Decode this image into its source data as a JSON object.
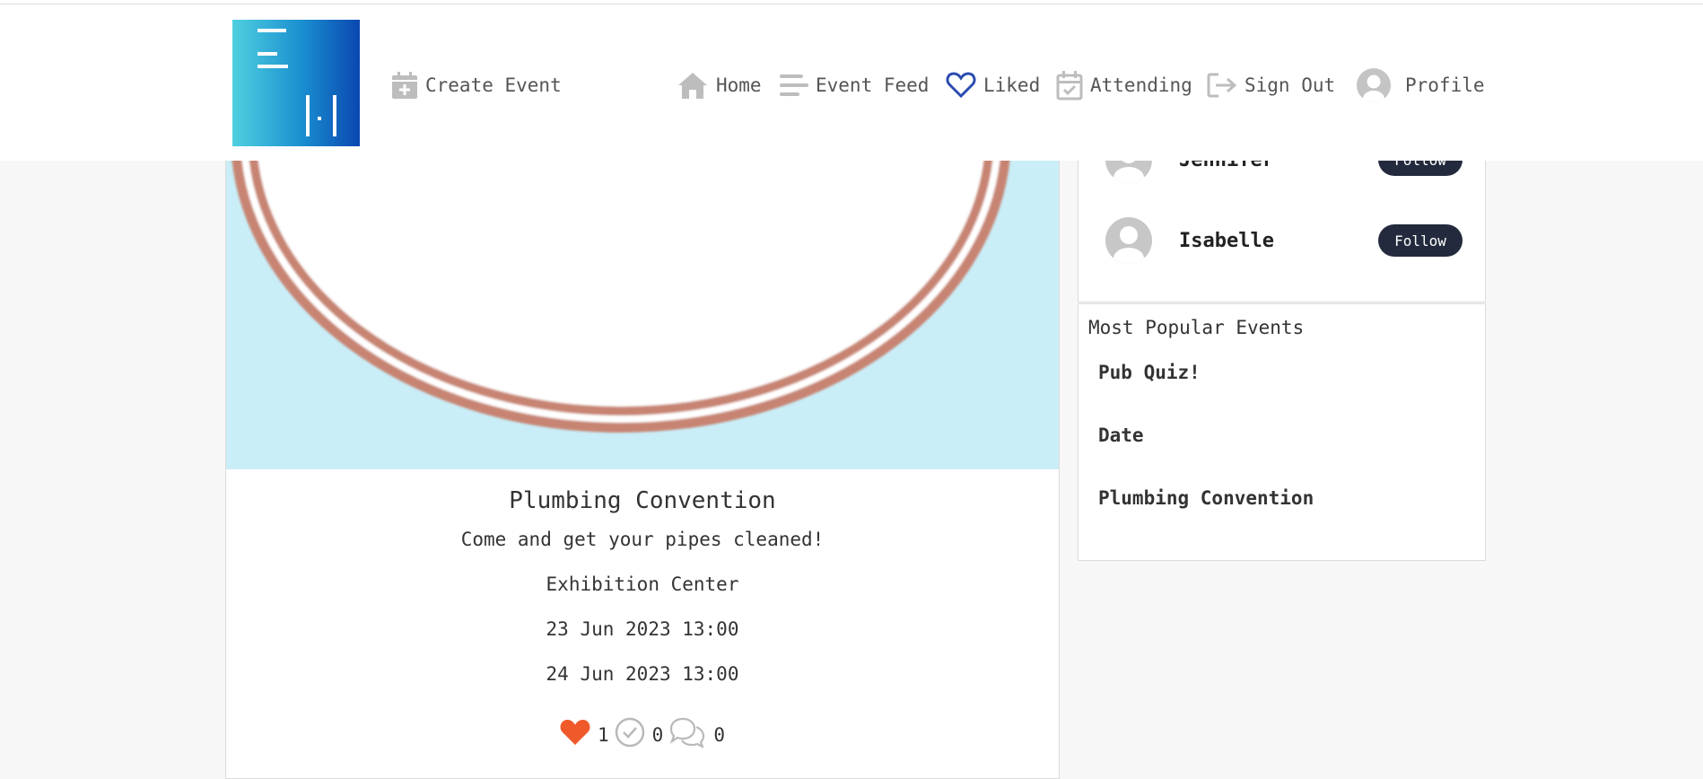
{
  "nav": {
    "create_event": "Create Event",
    "home": "Home",
    "event_feed": "Event Feed",
    "liked": "Liked",
    "attending": "Attending",
    "sign_out": "Sign Out",
    "profile": "Profile",
    "icons": [
      "calendar-plus-icon",
      "home-icon",
      "list-icon",
      "heart-icon",
      "calendar-check-icon",
      "sign-out-icon",
      "avatar"
    ]
  },
  "event": {
    "title": "Plumbing Convention",
    "description": "Come and get your pipes cleaned!",
    "location": "Exhibition Center",
    "start": "23 Jun 2023 13:00",
    "end": "24 Jun 2023 13:00",
    "likes": "1",
    "attending": "0",
    "comments": "0"
  },
  "profiles": [
    {
      "name": "Jennifer",
      "follow_label": "Follow"
    },
    {
      "name": "Isabelle",
      "follow_label": "Follow"
    }
  ],
  "popular": {
    "title": "Most Popular Events",
    "items": [
      "Pub Quiz!",
      "Date",
      "Plumbing Convention"
    ]
  },
  "colors": {
    "accent_heart": "#f05a2a",
    "liked_nav": "#2a4bb0",
    "follow_button": "#242a3d",
    "image_bg": "#c9eef8",
    "pipe": "#c88472"
  }
}
